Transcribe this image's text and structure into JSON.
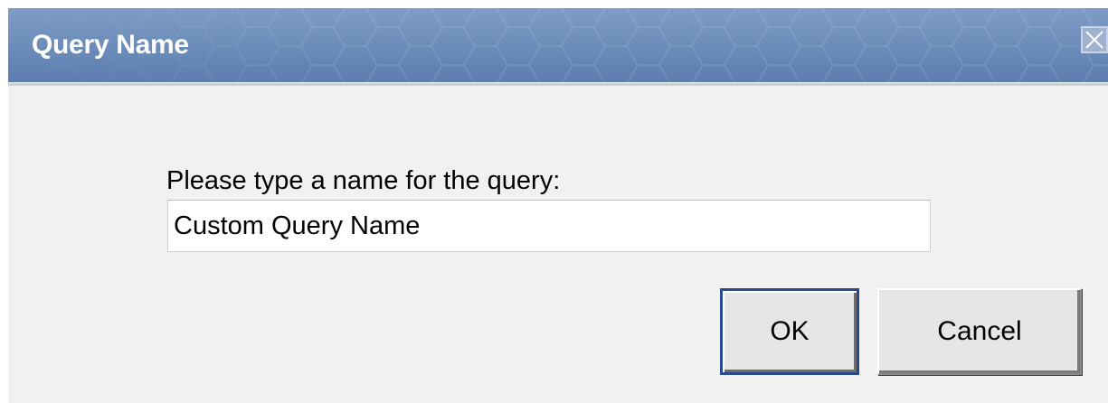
{
  "dialog": {
    "title": "Query Name",
    "close_icon": "close-icon",
    "prompt_label": "Please type a name for the query:",
    "name_input": {
      "value": "Custom Query Name",
      "placeholder": ""
    },
    "buttons": {
      "ok_label": "OK",
      "cancel_label": "Cancel"
    }
  },
  "colors": {
    "titlebar": "#6e8ebb",
    "body": "#f1f1f1",
    "default_button_border": "#2a4a8e"
  }
}
